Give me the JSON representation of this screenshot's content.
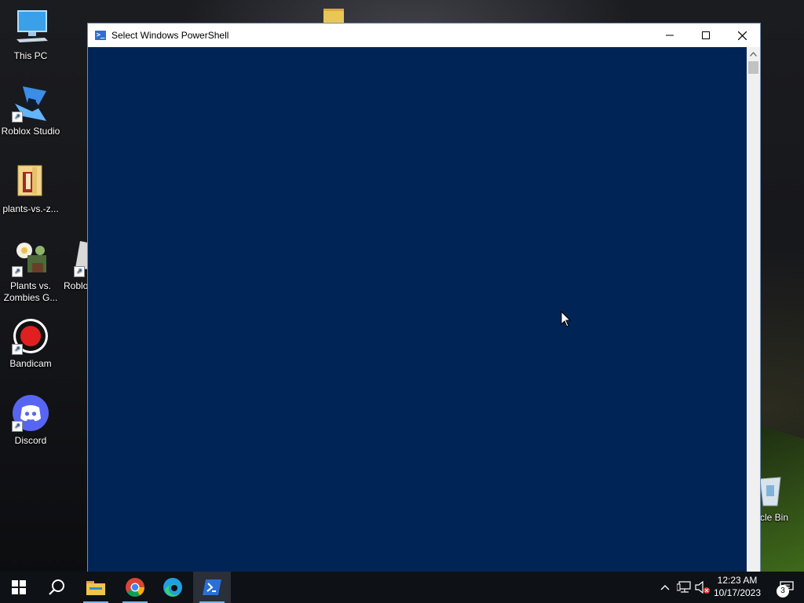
{
  "desktop": {
    "icons": [
      {
        "label": "This PC",
        "icon": "this-pc-icon"
      },
      {
        "label": "Roblox Studio",
        "icon": "roblox-studio-icon"
      },
      {
        "label": "plants-vs.-z...",
        "icon": "folder-zip-icon"
      },
      {
        "label": "Plants vs.\nZombies G...",
        "icon": "plants-vs-zombies-icon"
      },
      {
        "label": "Roblo",
        "icon": "roblox-icon"
      },
      {
        "label": "Bandicam",
        "icon": "bandicam-icon"
      },
      {
        "label": "Discord",
        "icon": "discord-icon"
      },
      {
        "label": "cle Bin",
        "icon": "recycle-bin-icon"
      }
    ]
  },
  "window": {
    "title": "Select Windows PowerShell",
    "console_bg": "#012456",
    "buttons": [
      "minimize",
      "maximize",
      "close"
    ]
  },
  "taskbar": {
    "apps": [
      {
        "name": "Start",
        "icon": "windows-start-icon"
      },
      {
        "name": "Search",
        "icon": "search-icon"
      },
      {
        "name": "File Explorer",
        "icon": "file-explorer-icon"
      },
      {
        "name": "Google Chrome",
        "icon": "chrome-icon"
      },
      {
        "name": "Microsoft Edge",
        "icon": "edge-icon"
      },
      {
        "name": "Windows PowerShell",
        "icon": "powershell-icon",
        "active": true
      }
    ],
    "clock": {
      "time": "12:23 AM",
      "date": "10/17/2023"
    },
    "notifications_count": "3"
  }
}
